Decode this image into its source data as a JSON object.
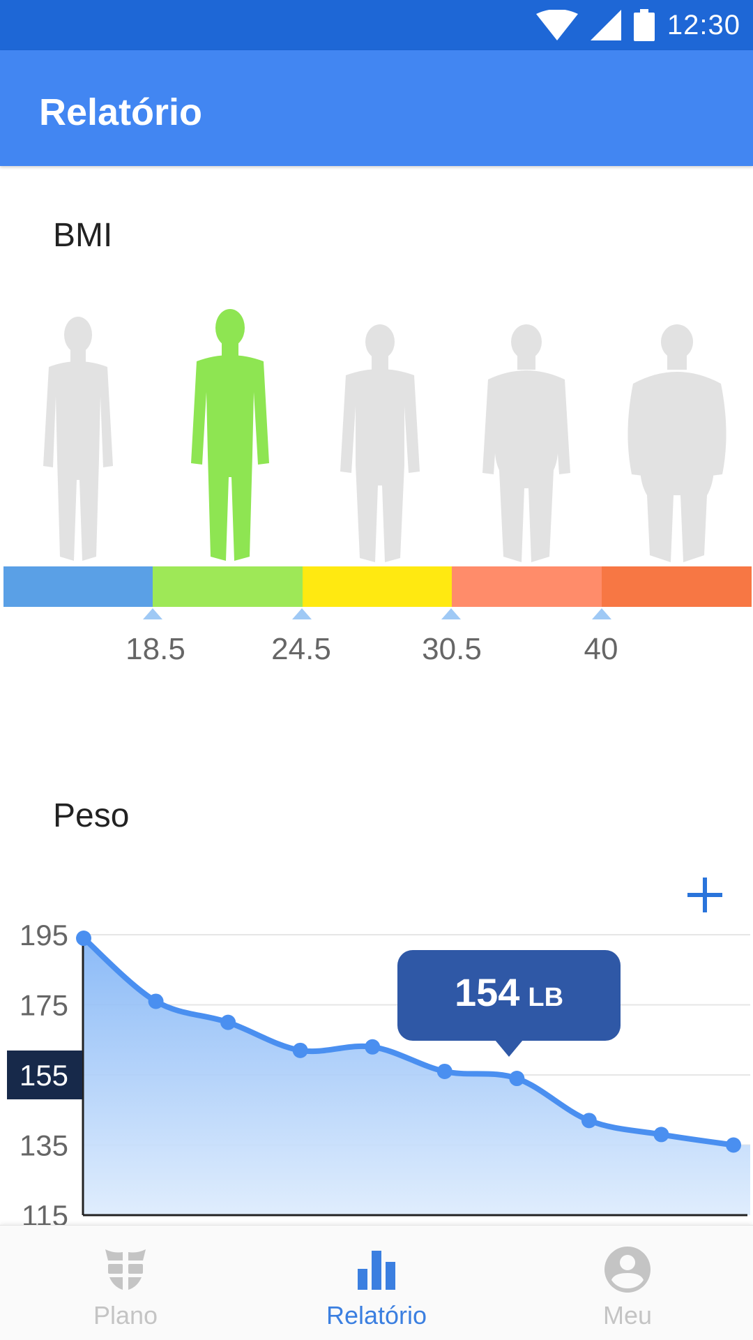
{
  "status_bar": {
    "time": "12:30",
    "icons": [
      "wifi-icon",
      "signal-icon",
      "battery-icon"
    ]
  },
  "app_bar": {
    "title": "Relatório"
  },
  "bmi": {
    "title": "BMI",
    "thresholds": [
      "18.5",
      "24.5",
      "30.5",
      "40"
    ],
    "segment_colors": [
      "#5aa0e6",
      "#9ee857",
      "#ffe911",
      "#ff8c6a",
      "#f77744"
    ],
    "active_figure_index": 1,
    "active_color": "#8ee552",
    "inactive_color": "#e2e2e2"
  },
  "weight": {
    "title": "Peso",
    "add_button": "add-icon",
    "tooltip_value": "154",
    "tooltip_unit": "LB",
    "highlighted_y": "155"
  },
  "chart_data": {
    "type": "area",
    "title": "Peso",
    "yticks": [
      "195",
      "175",
      "155",
      "135",
      "115"
    ],
    "ylim": [
      115,
      195
    ],
    "x": [
      1,
      2,
      3,
      4,
      5,
      6,
      7,
      8,
      9,
      10
    ],
    "series": [
      {
        "values": [
          194,
          176,
          170,
          162,
          163,
          156,
          154,
          142,
          138,
          135
        ]
      }
    ],
    "highlight_index": 6,
    "grid": true,
    "accent": "#4a8ff0"
  },
  "bottom_nav": {
    "items": [
      {
        "label": "Plano",
        "icon": "abs-icon",
        "active": false
      },
      {
        "label": "Relatório",
        "icon": "bar-chart-icon",
        "active": true
      },
      {
        "label": "Meu",
        "icon": "profile-icon",
        "active": false
      }
    ],
    "active_color": "#3b7fe0",
    "inactive_color": "#c4c4c4"
  }
}
